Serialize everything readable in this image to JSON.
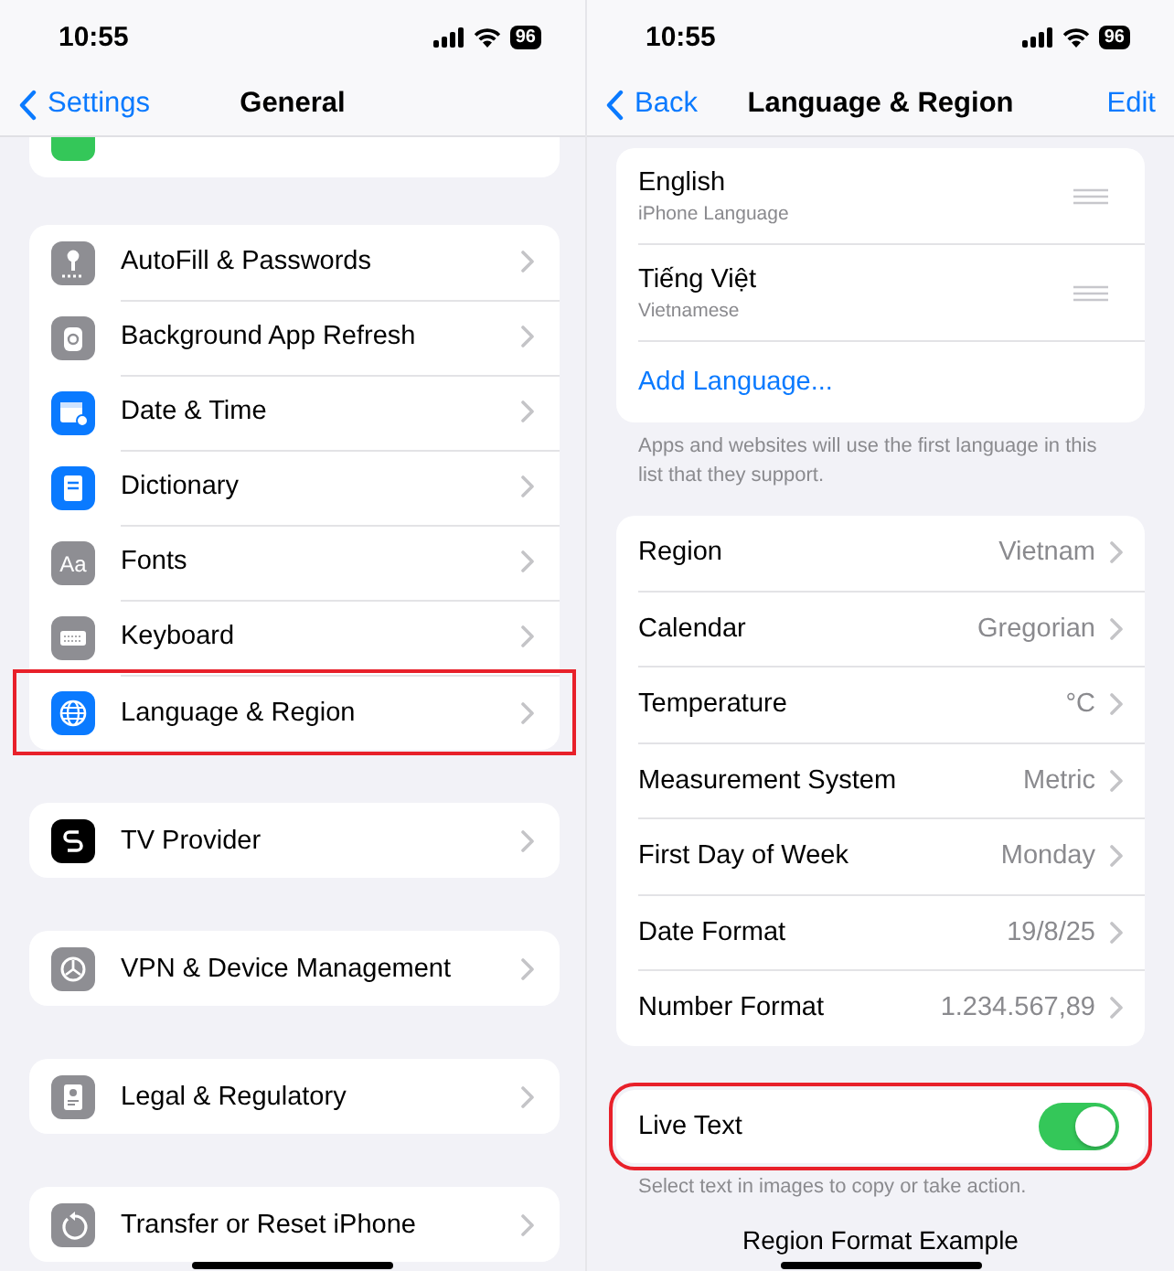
{
  "left": {
    "status": {
      "time": "10:55",
      "battery": "96"
    },
    "nav": {
      "back": "Settings",
      "title": "General"
    },
    "groups": [
      [
        {
          "label": "AutoFill & Passwords",
          "highlighted": false
        },
        {
          "label": "Background App Refresh",
          "highlighted": false
        },
        {
          "label": "Date & Time",
          "highlighted": false
        },
        {
          "label": "Dictionary",
          "highlighted": false
        },
        {
          "label": "Fonts",
          "highlighted": false,
          "icon_glyph": "Aa"
        },
        {
          "label": "Keyboard",
          "highlighted": false
        },
        {
          "label": "Language & Region",
          "highlighted": true
        }
      ],
      [
        {
          "label": "TV Provider",
          "highlighted": false
        }
      ],
      [
        {
          "label": "VPN & Device Management",
          "highlighted": false
        }
      ],
      [
        {
          "label": "Legal & Regulatory",
          "highlighted": false
        }
      ],
      [
        {
          "label": "Transfer or Reset iPhone",
          "highlighted": false
        }
      ]
    ]
  },
  "right": {
    "status": {
      "time": "10:55",
      "battery": "96"
    },
    "nav": {
      "back": "Back",
      "title": "Language & Region",
      "action": "Edit"
    },
    "languages": [
      {
        "name": "English",
        "subtitle": "iPhone Language"
      },
      {
        "name": "Tiếng Việt",
        "subtitle": "Vietnamese"
      }
    ],
    "add_language": "Add Language...",
    "language_note": "Apps and websites will use the first language in this list that they support.",
    "region_rows": [
      {
        "label": "Region",
        "value": "Vietnam"
      },
      {
        "label": "Calendar",
        "value": "Gregorian"
      },
      {
        "label": "Temperature",
        "value": "°C"
      },
      {
        "label": "Measurement System",
        "value": "Metric"
      },
      {
        "label": "First Day of Week",
        "value": "Monday"
      },
      {
        "label": "Date Format",
        "value": "19/8/25"
      },
      {
        "label": "Number Format",
        "value": "1.234.567,89"
      }
    ],
    "live_text": {
      "label": "Live Text",
      "on": true,
      "highlighted": true
    },
    "live_text_note": "Select text in images to copy or take action.",
    "region_format_heading": "Region Format Example"
  }
}
